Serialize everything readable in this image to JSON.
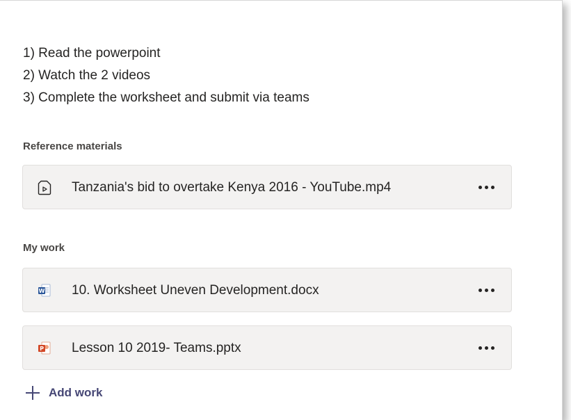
{
  "instructions": {
    "steps": [
      "1) Read the powerpoint",
      "2) Watch the 2 videos",
      "3) Complete the worksheet and submit via teams"
    ]
  },
  "reference_materials": {
    "label": "Reference materials",
    "items": [
      {
        "name": "Tanzania's bid to overtake Kenya 2016 - YouTube.mp4",
        "icon": "video-file-icon"
      }
    ]
  },
  "my_work": {
    "label": "My work",
    "items": [
      {
        "name": "10. Worksheet Uneven Development.docx",
        "icon": "word-doc-icon",
        "color": "#2b579a"
      },
      {
        "name": "Lesson 10 2019- Teams.pptx",
        "icon": "powerpoint-icon",
        "color": "#d24726"
      }
    ]
  },
  "add_work": {
    "label": "Add work"
  }
}
